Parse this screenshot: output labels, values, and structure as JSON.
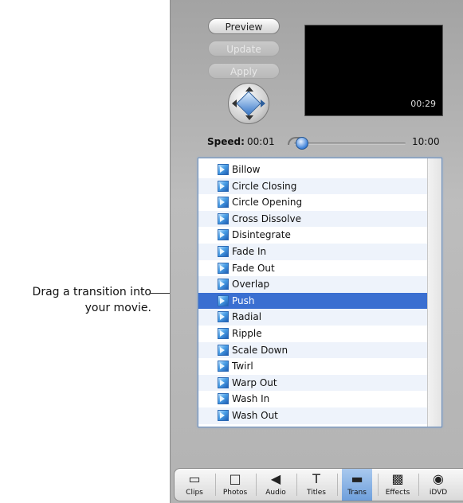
{
  "callout": {
    "line1": "Drag a transition into",
    "line2": "your movie."
  },
  "controls": {
    "preview_label": "Preview",
    "update_label": "Update",
    "apply_label": "Apply"
  },
  "preview": {
    "time": "00:29"
  },
  "speed": {
    "label": "Speed:",
    "min": "00:01",
    "max": "10:00"
  },
  "transitions": [
    {
      "label": "Billow"
    },
    {
      "label": "Circle Closing"
    },
    {
      "label": "Circle Opening"
    },
    {
      "label": "Cross Dissolve"
    },
    {
      "label": "Disintegrate"
    },
    {
      "label": "Fade In"
    },
    {
      "label": "Fade Out"
    },
    {
      "label": "Overlap"
    },
    {
      "label": "Push",
      "selected": true
    },
    {
      "label": "Radial"
    },
    {
      "label": "Ripple"
    },
    {
      "label": "Scale Down"
    },
    {
      "label": "Twirl"
    },
    {
      "label": "Warp Out"
    },
    {
      "label": "Wash In"
    },
    {
      "label": "Wash Out"
    }
  ],
  "toolbar": {
    "items": [
      {
        "label": "Clips",
        "icon": "clips-icon",
        "glyph": "▭"
      },
      {
        "label": "Photos",
        "icon": "photos-icon",
        "glyph": "□"
      },
      {
        "label": "Audio",
        "icon": "audio-icon",
        "glyph": "◀"
      },
      {
        "label": "Titles",
        "icon": "titles-icon",
        "glyph": "T"
      },
      {
        "label": "Trans",
        "icon": "trans-icon",
        "glyph": "▬",
        "selected": true
      },
      {
        "label": "Effects",
        "icon": "effects-icon",
        "glyph": "▩"
      },
      {
        "label": "iDVD",
        "icon": "idvd-icon",
        "glyph": "◉"
      }
    ]
  },
  "colors": {
    "selection": "#3a6fd1",
    "panel": "#b3b3b3"
  }
}
